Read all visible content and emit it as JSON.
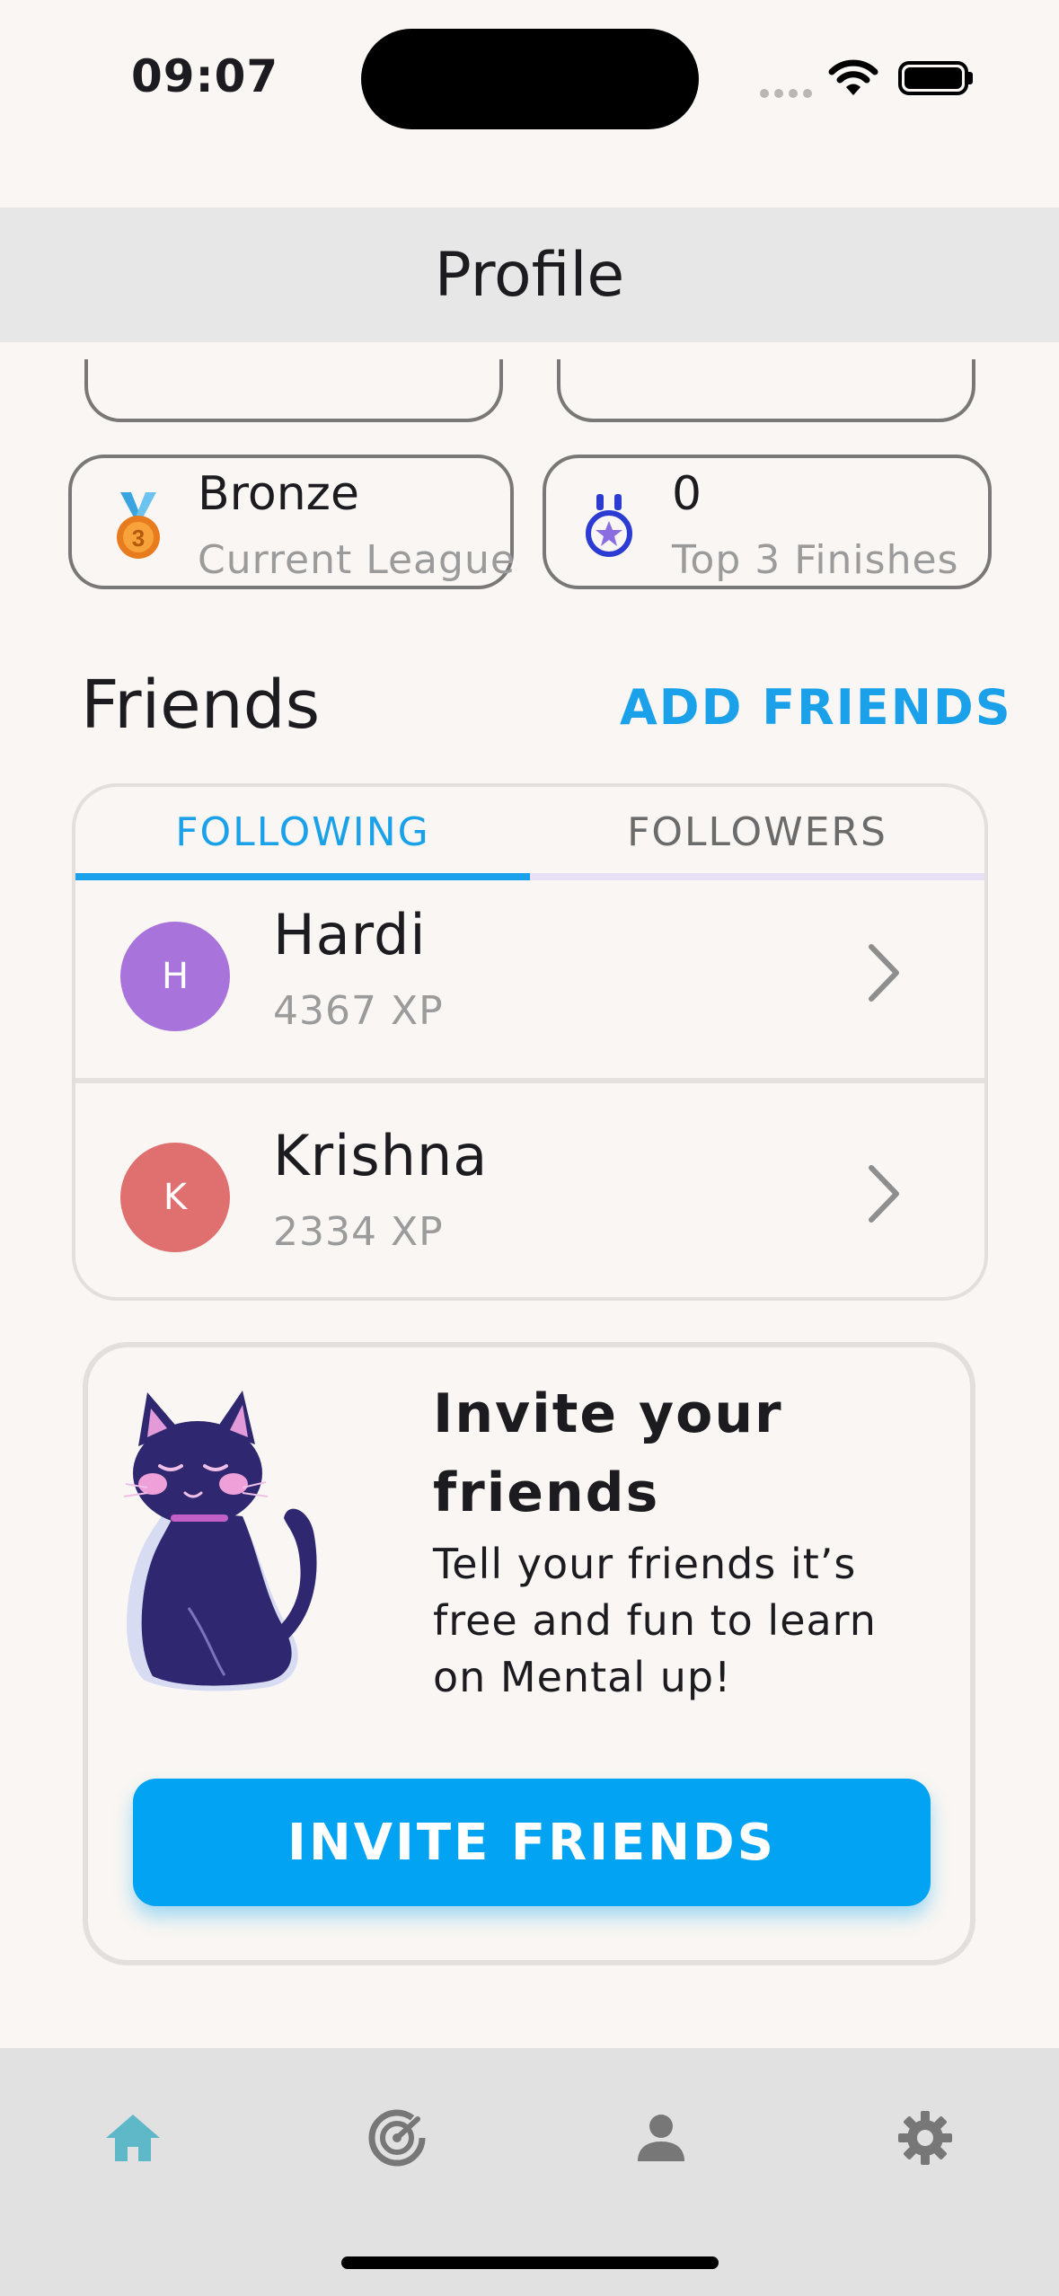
{
  "status_bar": {
    "time": "09:07"
  },
  "header": {
    "title": "Profile"
  },
  "stats": [
    {
      "value": "Bronze",
      "label": "Current League",
      "icon": "bronze-medal-icon"
    },
    {
      "value": "0",
      "label": "Top 3 Finishes",
      "icon": "star-medal-icon"
    }
  ],
  "friends": {
    "title": "Friends",
    "add_label": "ADD FRIENDS",
    "tabs": [
      {
        "label": "FOLLOWING",
        "active": true
      },
      {
        "label": "FOLLOWERS",
        "active": false
      }
    ],
    "list": [
      {
        "initial": "H",
        "name": "Hardi",
        "xp": "4367 XP",
        "color": "#a874dc"
      },
      {
        "initial": "K",
        "name": "Krishna",
        "xp": "2334 XP",
        "color": "#e07070"
      }
    ]
  },
  "invite": {
    "title": "Invite your friends",
    "description": "Tell your friends it’s free and fun to learn on Mental up!",
    "button_label": "INVITE FRIENDS"
  },
  "bottom_nav": [
    {
      "name": "home",
      "icon": "home-icon",
      "active": true
    },
    {
      "name": "activity",
      "icon": "radar-icon",
      "active": false
    },
    {
      "name": "profile",
      "icon": "person-icon",
      "active": false
    },
    {
      "name": "settings",
      "icon": "gear-icon",
      "active": false
    }
  ],
  "colors": {
    "accent": "#1aa1ea",
    "button": "#03a3f4",
    "background": "#f9f6f3",
    "nav_active": "#5fb8c8",
    "nav_inactive": "#777777"
  }
}
